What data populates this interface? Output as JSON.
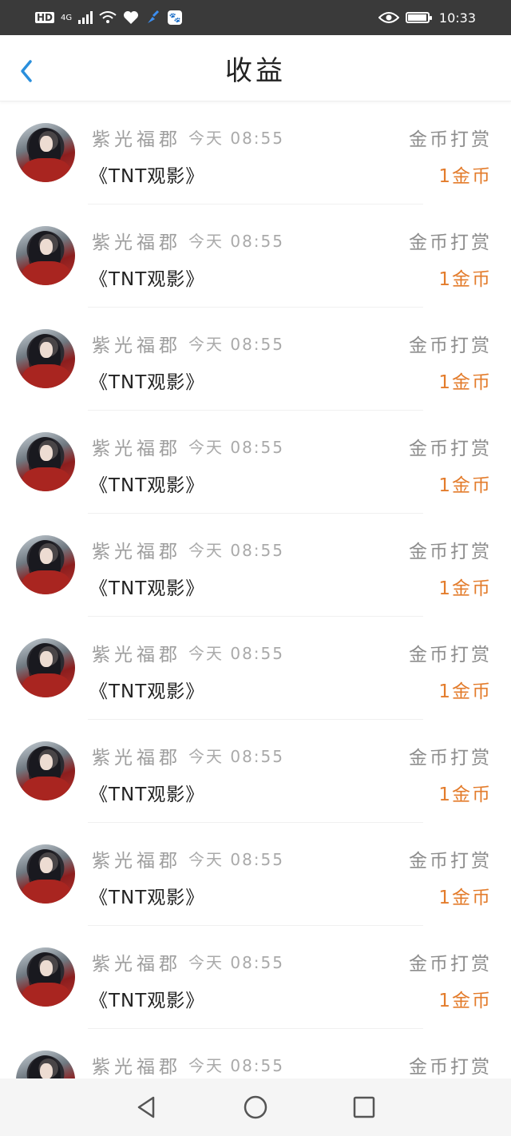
{
  "status_bar": {
    "hd": "HD",
    "network": "4G",
    "time": "10:33"
  },
  "header": {
    "title": "收益"
  },
  "records": [
    {
      "sender": "紫光福郡",
      "time": "今天 08:55",
      "type": "金币打赏",
      "work": "《TNT观影》",
      "amount": "1金币"
    },
    {
      "sender": "紫光福郡",
      "time": "今天 08:55",
      "type": "金币打赏",
      "work": "《TNT观影》",
      "amount": "1金币"
    },
    {
      "sender": "紫光福郡",
      "time": "今天 08:55",
      "type": "金币打赏",
      "work": "《TNT观影》",
      "amount": "1金币"
    },
    {
      "sender": "紫光福郡",
      "time": "今天 08:55",
      "type": "金币打赏",
      "work": "《TNT观影》",
      "amount": "1金币"
    },
    {
      "sender": "紫光福郡",
      "time": "今天 08:55",
      "type": "金币打赏",
      "work": "《TNT观影》",
      "amount": "1金币"
    },
    {
      "sender": "紫光福郡",
      "time": "今天 08:55",
      "type": "金币打赏",
      "work": "《TNT观影》",
      "amount": "1金币"
    },
    {
      "sender": "紫光福郡",
      "time": "今天 08:55",
      "type": "金币打赏",
      "work": "《TNT观影》",
      "amount": "1金币"
    },
    {
      "sender": "紫光福郡",
      "time": "今天 08:55",
      "type": "金币打赏",
      "work": "《TNT观影》",
      "amount": "1金币"
    },
    {
      "sender": "紫光福郡",
      "time": "今天 08:55",
      "type": "金币打赏",
      "work": "《TNT观影》",
      "amount": "1金币"
    },
    {
      "sender": "紫光福郡",
      "time": "今天 08:55",
      "type": "金币打赏"
    }
  ],
  "colors": {
    "accent": "#2a8fdc",
    "amount": "#e37c2c",
    "status_bar": "#3a3a3a"
  },
  "icons": {
    "back": "chevron-left-icon",
    "nav_back": "triangle-back-icon",
    "nav_home": "circle-home-icon",
    "nav_recents": "square-recents-icon"
  }
}
